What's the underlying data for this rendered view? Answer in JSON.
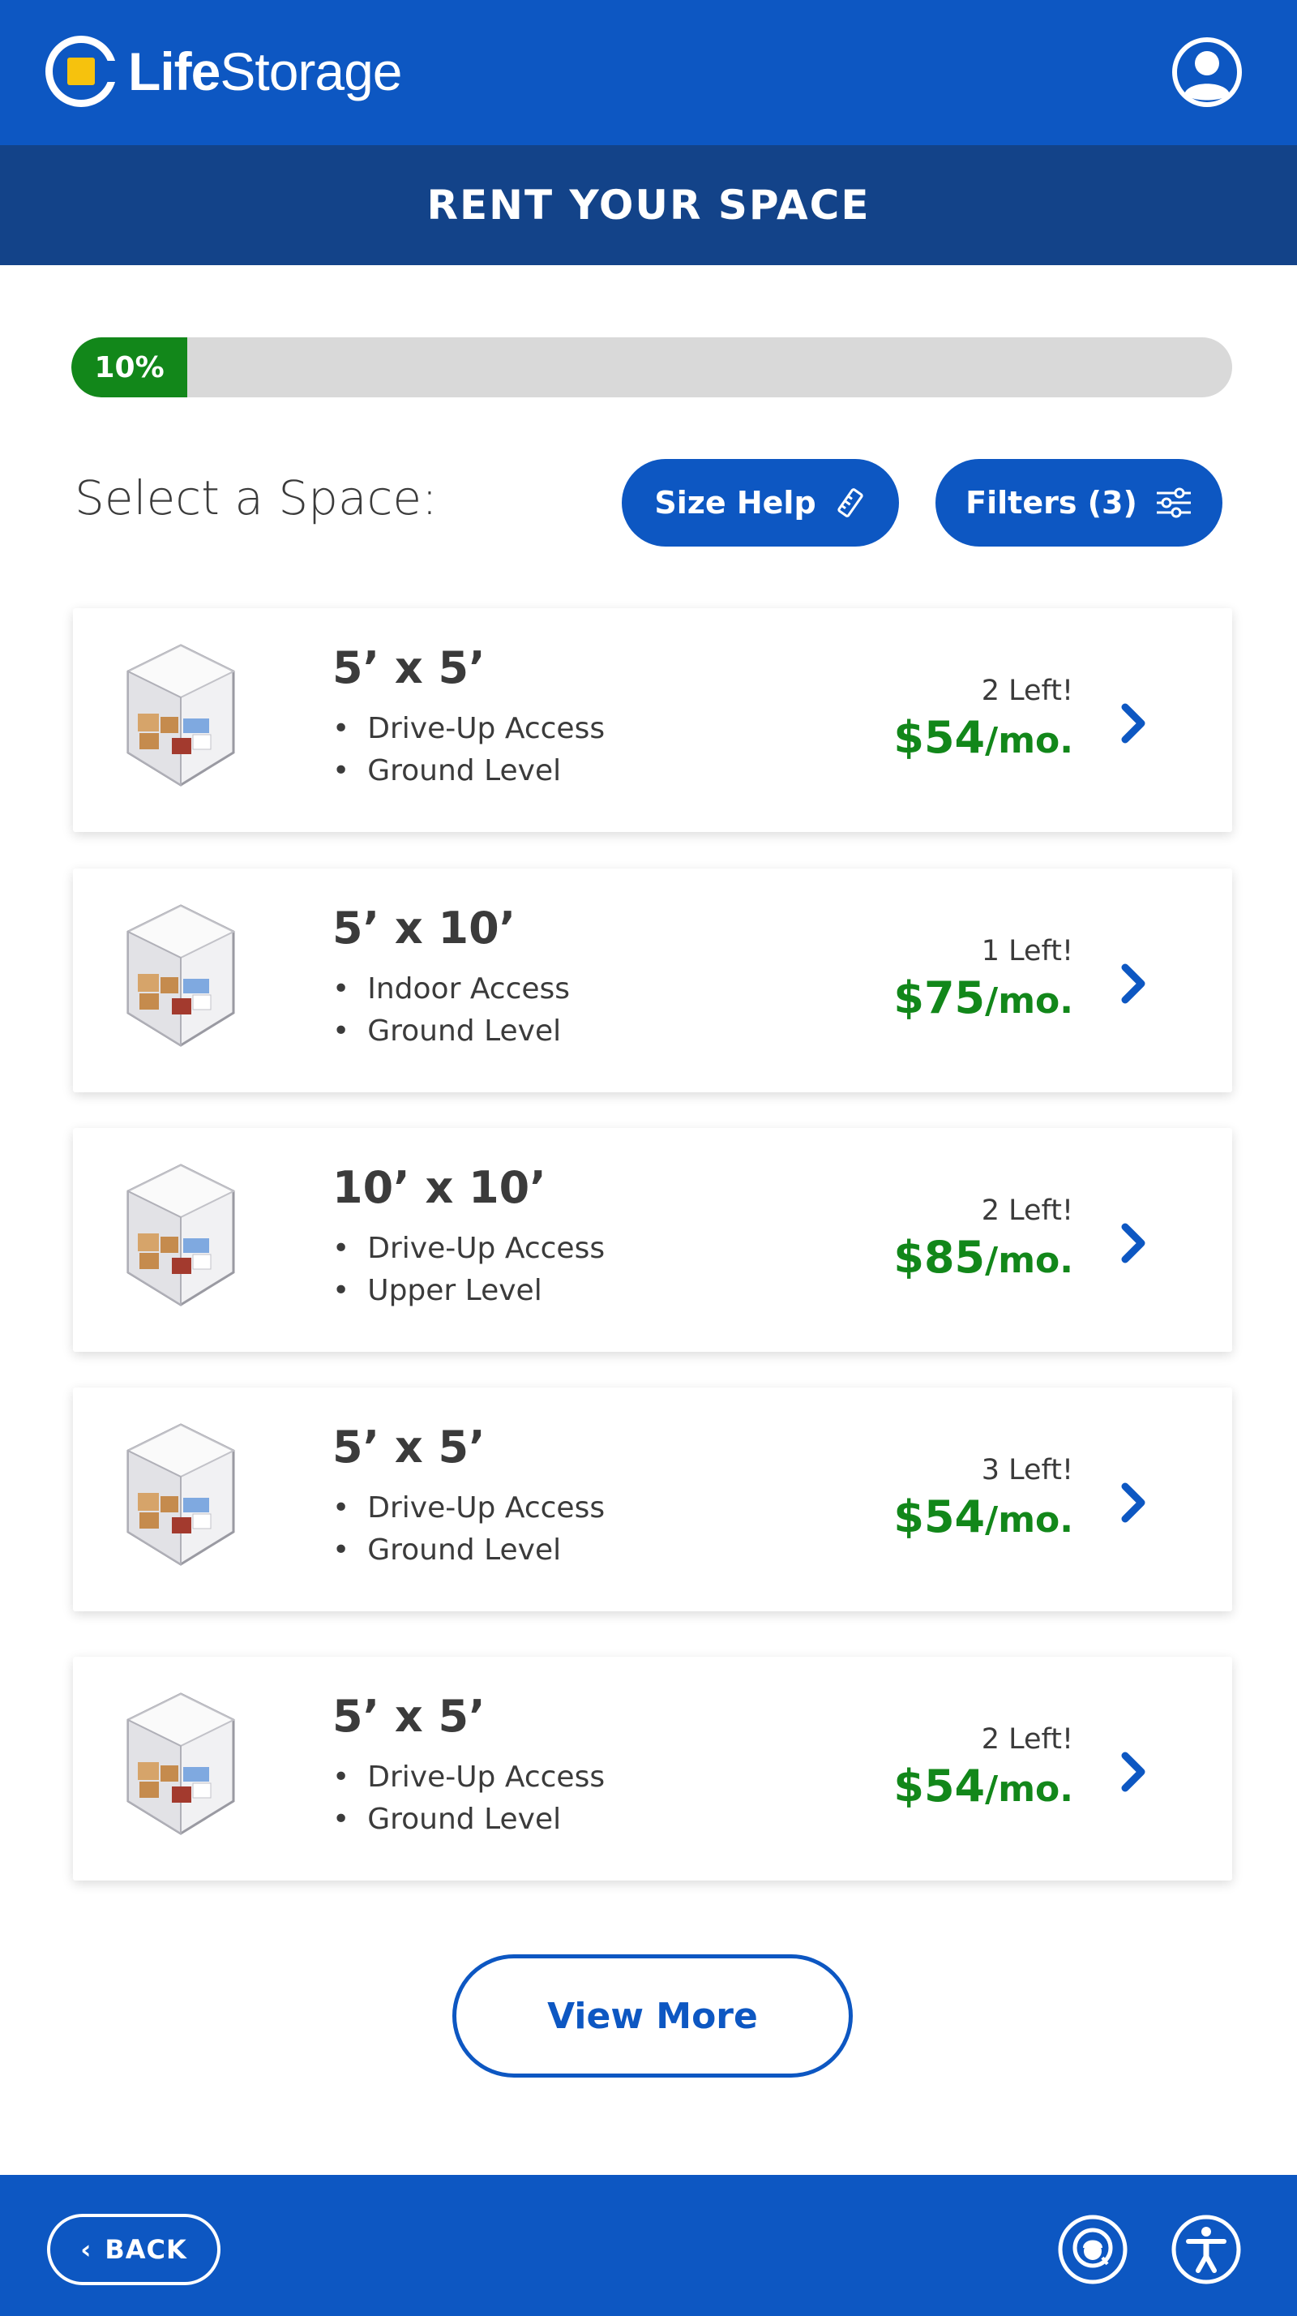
{
  "header": {
    "logo_bold": "Life",
    "logo_light": "Storage",
    "title": "RENT YOUR SPACE"
  },
  "progress": {
    "label": "10%",
    "value": 0.1
  },
  "select": {
    "label": "Select a Space:",
    "size_help": "Size Help",
    "filters": "Filters (3)"
  },
  "units": [
    {
      "dims": "5’ x 5’",
      "feature1": "Drive-Up Access",
      "feature2": "Ground Level",
      "left": "2 Left!",
      "price": "$54",
      "per": "/mo."
    },
    {
      "dims": "5’ x 10’",
      "feature1": "Indoor Access",
      "feature2": "Ground Level",
      "left": "1 Left!",
      "price": "$75",
      "per": "/mo."
    },
    {
      "dims": "10’ x 10’",
      "feature1": "Drive-Up Access",
      "feature2": "Upper Level",
      "left": "2 Left!",
      "price": "$85",
      "per": "/mo."
    },
    {
      "dims": "5’ x 5’",
      "feature1": "Drive-Up Access",
      "feature2": "Ground Level",
      "left": "3 Left!",
      "price": "$54",
      "per": "/mo."
    },
    {
      "dims": "5’ x 5’",
      "feature1": "Drive-Up Access",
      "feature2": "Ground Level",
      "left": "2 Left!",
      "price": "$54",
      "per": "/mo."
    }
  ],
  "view_more": "View More",
  "footer": {
    "back": "BACK"
  },
  "icons": {
    "account": "user-circle-icon",
    "ruler": "ruler-icon",
    "sliders": "sliders-icon",
    "chevron": "chevron-right-icon",
    "chat": "chat-support-icon",
    "accessibility": "accessibility-icon"
  },
  "colors": {
    "brand_blue": "#0d57c2",
    "dark_blue": "#134389",
    "green": "#12871a",
    "logo_yellow": "#f6c20d"
  }
}
